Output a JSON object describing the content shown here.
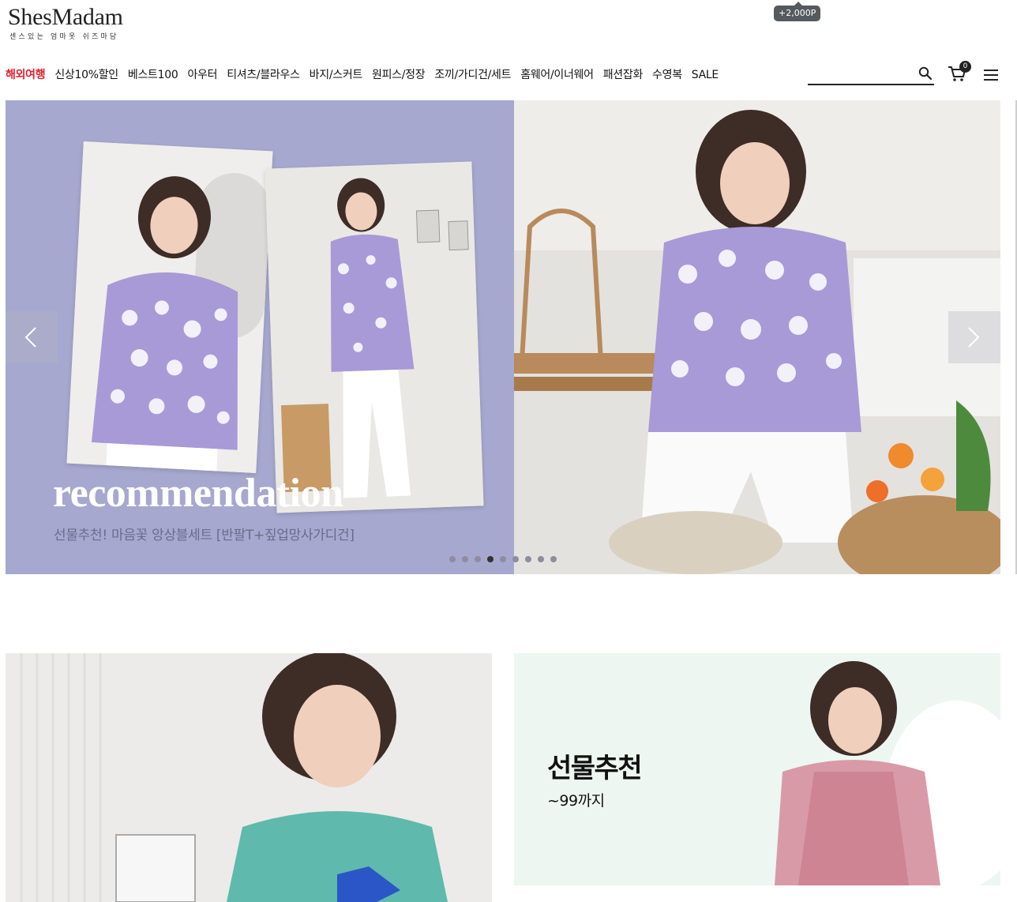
{
  "header": {
    "logo_text": "ShesMadam",
    "logo_sub": "센스있는 엄마옷 쉬즈마담",
    "points_badge": "+2,000P",
    "search_placeholder": "",
    "cart_count": "0"
  },
  "nav": {
    "items": [
      {
        "label": "해외여행"
      },
      {
        "label": "신상10%할인"
      },
      {
        "label": "베스트100"
      },
      {
        "label": "아우터"
      },
      {
        "label": "티셔츠/블라우스"
      },
      {
        "label": "바지/스커트"
      },
      {
        "label": "원피스/정장"
      },
      {
        "label": "조끼/가디건/세트"
      },
      {
        "label": "홈웨어/이너웨어"
      },
      {
        "label": "패션잡화"
      },
      {
        "label": "수영복"
      },
      {
        "label": "SALE"
      }
    ]
  },
  "hero": {
    "title": "recommendation",
    "caption": "선물추천! 마음꽃 앙상블세트 [반팔T+짚업망사가디건]",
    "slide_count": 9,
    "active_slide": 4
  },
  "promo": {
    "right_title": "선물추천",
    "right_sub": "~99까지"
  },
  "colors": {
    "accent_red": "#e01e2d",
    "hero_lavender": "#a7a8cf",
    "badge_gray": "#555a5f"
  }
}
